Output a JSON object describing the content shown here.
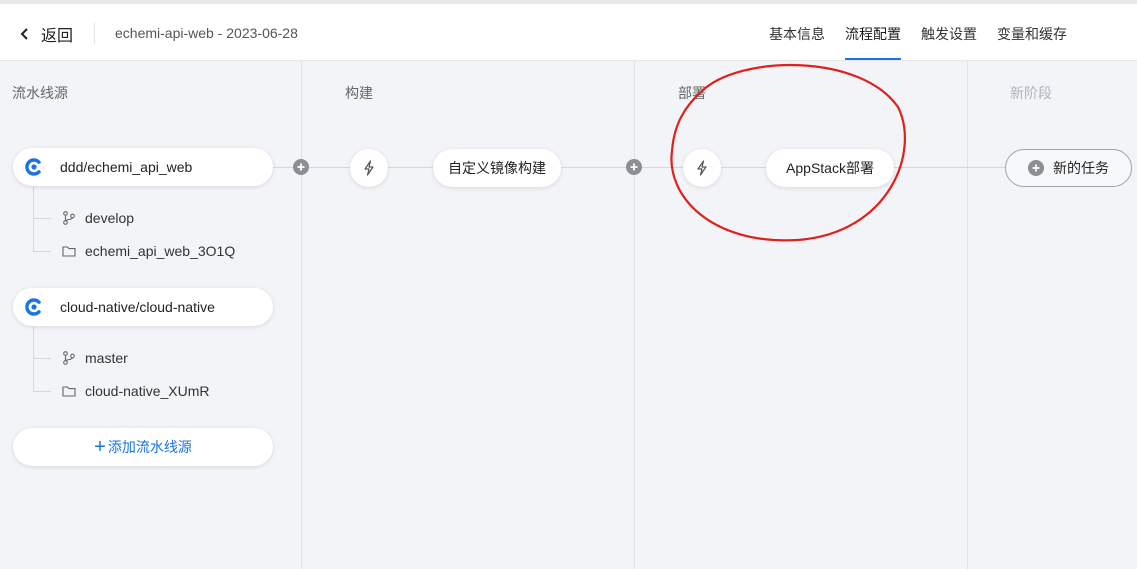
{
  "header": {
    "back_label": "返回",
    "pipeline_title": "echemi-api-web - 2023-06-28",
    "tabs": [
      {
        "label": "基本信息",
        "active": false
      },
      {
        "label": "流程配置",
        "active": true
      },
      {
        "label": "触发设置",
        "active": false
      },
      {
        "label": "变量和缓存",
        "active": false
      }
    ]
  },
  "stages": {
    "sources": {
      "title": "流水线源"
    },
    "build": {
      "title": "构建"
    },
    "deploy": {
      "title": "部署"
    },
    "new_stage": {
      "title": "新阶段"
    }
  },
  "sources": [
    {
      "name": "ddd/echemi_api_web",
      "branch": "develop",
      "folder": "echemi_api_web_3O1Q"
    },
    {
      "name": "cloud-native/cloud-native",
      "branch": "master",
      "folder": "cloud-native_XUmR"
    }
  ],
  "add_source_label": "添加流水线源",
  "jobs": {
    "build_job": "自定义镜像构建",
    "deploy_job": "AppStack部署",
    "new_task": "新的任务"
  },
  "icons": {
    "back": "chevron-left-icon",
    "source_logo": "codeup-logo-icon",
    "branch": "git-branch-icon",
    "folder": "folder-icon",
    "trigger": "lightning-icon",
    "plus": "plus-circle-icon"
  },
  "colors": {
    "accent": "#1a73e8",
    "annotation": "#e0201b",
    "background": "#f2f4f7"
  }
}
